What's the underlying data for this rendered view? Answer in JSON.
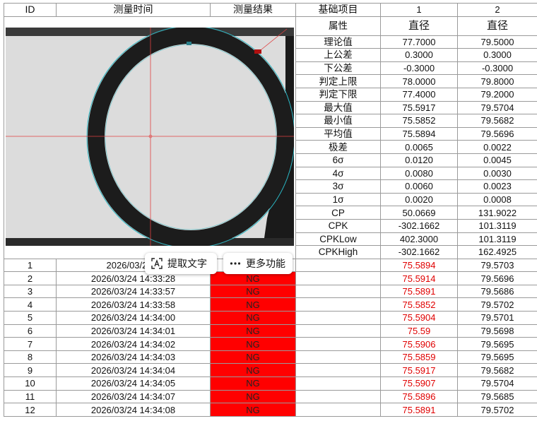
{
  "header": {
    "id": "ID",
    "time": "测量时间",
    "result": "测量结果",
    "base_item": "基础项目",
    "col1": "1",
    "col2": "2"
  },
  "stats": [
    {
      "label": "属性",
      "v1": "直径",
      "v2": "直径"
    },
    {
      "label": "理论值",
      "v1": "77.7000",
      "v2": "79.5000"
    },
    {
      "label": "上公差",
      "v1": "0.3000",
      "v2": "0.3000"
    },
    {
      "label": "下公差",
      "v1": "-0.3000",
      "v2": "-0.3000"
    },
    {
      "label": "判定上限",
      "v1": "78.0000",
      "v2": "79.8000"
    },
    {
      "label": "判定下限",
      "v1": "77.4000",
      "v2": "79.2000"
    },
    {
      "label": "最大值",
      "v1": "75.5917",
      "v2": "79.5704"
    },
    {
      "label": "最小值",
      "v1": "75.5852",
      "v2": "79.5682"
    },
    {
      "label": "平均值",
      "v1": "75.5894",
      "v2": "79.5696"
    },
    {
      "label": "极差",
      "v1": "0.0065",
      "v2": "0.0022"
    },
    {
      "label": "6σ",
      "v1": "0.0120",
      "v2": "0.0045"
    },
    {
      "label": "4σ",
      "v1": "0.0080",
      "v2": "0.0030"
    },
    {
      "label": "3σ",
      "v1": "0.0060",
      "v2": "0.0023"
    },
    {
      "label": "1σ",
      "v1": "0.0020",
      "v2": "0.0008"
    },
    {
      "label": "CP",
      "v1": "50.0669",
      "v2": "131.9022"
    },
    {
      "label": "CPK",
      "v1": "-302.1662",
      "v2": "101.3119"
    },
    {
      "label": "CPKLow",
      "v1": "402.3000",
      "v2": "101.3119"
    },
    {
      "label": "CPKHigh",
      "v1": "-302.1662",
      "v2": "162.4925"
    }
  ],
  "rows": [
    {
      "id": "1",
      "time": "2026/03/24 1",
      "result": "",
      "v1": "75.5894",
      "v2": "79.5703"
    },
    {
      "id": "2",
      "time": "2026/03/24 14:33:28",
      "result": "NG",
      "v1": "75.5914",
      "v2": "79.5696"
    },
    {
      "id": "3",
      "time": "2026/03/24 14:33:57",
      "result": "NG",
      "v1": "75.5891",
      "v2": "79.5686"
    },
    {
      "id": "4",
      "time": "2026/03/24 14:33:58",
      "result": "NG",
      "v1": "75.5852",
      "v2": "79.5702"
    },
    {
      "id": "5",
      "time": "2026/03/24 14:34:00",
      "result": "NG",
      "v1": "75.5904",
      "v2": "79.5701"
    },
    {
      "id": "6",
      "time": "2026/03/24 14:34:01",
      "result": "NG",
      "v1": "75.59",
      "v2": "79.5698"
    },
    {
      "id": "7",
      "time": "2026/03/24 14:34:02",
      "result": "NG",
      "v1": "75.5906",
      "v2": "79.5695"
    },
    {
      "id": "8",
      "time": "2026/03/24 14:34:03",
      "result": "NG",
      "v1": "75.5859",
      "v2": "79.5695"
    },
    {
      "id": "9",
      "time": "2026/03/24 14:34:04",
      "result": "NG",
      "v1": "75.5917",
      "v2": "79.5682"
    },
    {
      "id": "10",
      "time": "2026/03/24 14:34:05",
      "result": "NG",
      "v1": "75.5907",
      "v2": "79.5704"
    },
    {
      "id": "11",
      "time": "2026/03/24 14:34:07",
      "result": "NG",
      "v1": "75.5896",
      "v2": "79.5685"
    },
    {
      "id": "12",
      "time": "2026/03/24 14:34:08",
      "result": "NG",
      "v1": "75.5891",
      "v2": "79.5702"
    }
  ],
  "toolbar": {
    "extract_text": "提取文字",
    "more_features": "更多功能"
  },
  "colors": {
    "ng_fill": "#ff0000",
    "out_of_tolerance_text": "#e00000",
    "fit_circle": "#2bb5c2",
    "crosshair": "#e04040"
  },
  "icons": {
    "extract": "text-scan-icon",
    "more": "ellipsis-icon"
  }
}
